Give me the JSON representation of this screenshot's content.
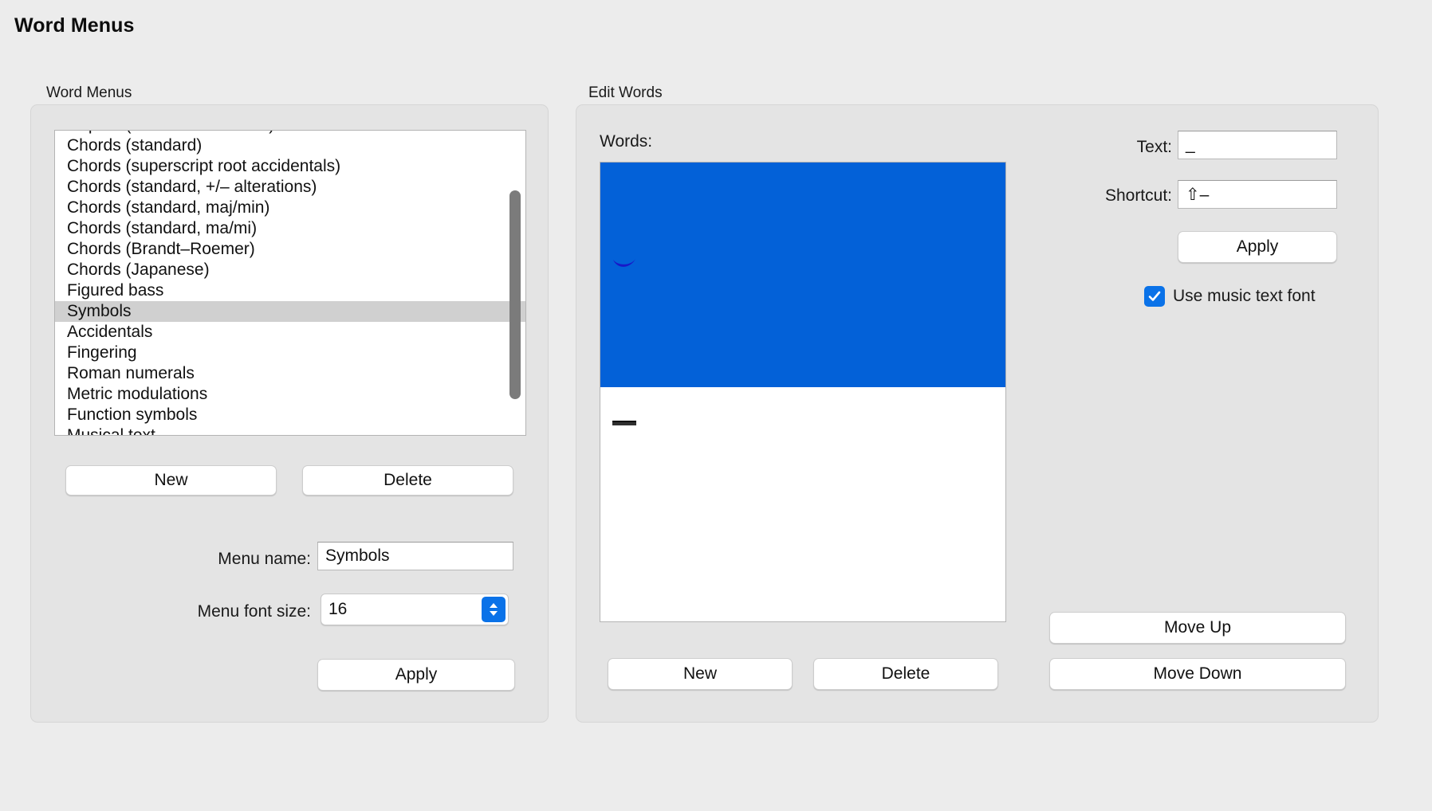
{
  "window": {
    "title": "Word Menus"
  },
  "left_panel": {
    "group_label": "Word Menus",
    "menu_list": [
      {
        "label": "Repeat (D.C./D.S./To Coda)",
        "selected": false
      },
      {
        "label": "Chords (standard)",
        "selected": false
      },
      {
        "label": "Chords (superscript root accidentals)",
        "selected": false
      },
      {
        "label": "Chords (standard, +/– alterations)",
        "selected": false
      },
      {
        "label": "Chords (standard, maj/min)",
        "selected": false
      },
      {
        "label": "Chords (standard, ma/mi)",
        "selected": false
      },
      {
        "label": "Chords (Brandt–Roemer)",
        "selected": false
      },
      {
        "label": "Chords (Japanese)",
        "selected": false
      },
      {
        "label": "Figured bass",
        "selected": false
      },
      {
        "label": "Symbols",
        "selected": true
      },
      {
        "label": "Accidentals",
        "selected": false
      },
      {
        "label": "Fingering",
        "selected": false
      },
      {
        "label": "Roman numerals",
        "selected": false
      },
      {
        "label": "Metric modulations",
        "selected": false
      },
      {
        "label": "Function symbols",
        "selected": false
      },
      {
        "label": "Musical text",
        "selected": false
      }
    ],
    "new_button": "New",
    "delete_button": "Delete",
    "menu_name_label": "Menu name:",
    "menu_name_value": "Symbols",
    "menu_font_size_label": "Menu font size:",
    "menu_font_size_value": "16",
    "apply_button": "Apply"
  },
  "right_panel": {
    "group_label": "Edit Words",
    "words_label": "Words:",
    "words_list": [
      {
        "glyph": "slur-below",
        "selected": true
      },
      {
        "glyph": "tenuto-dash",
        "selected": false
      }
    ],
    "text_label": "Text:",
    "text_value": "_",
    "shortcut_label": "Shortcut:",
    "shortcut_value": "⇧–",
    "apply_button": "Apply",
    "use_music_font_label": "Use music text font",
    "use_music_font_checked": true,
    "new_button": "New",
    "delete_button": "Delete",
    "move_up_button": "Move Up",
    "move_down_button": "Move Down"
  },
  "colors": {
    "window_background": "#ececec",
    "group_background": "#e4e4e4",
    "selection_blue": "#0361d8",
    "accent_blue": "#0a72e8",
    "list_selection_gray": "#d0d0d0",
    "scrollbar_thumb": "#7b7b7b"
  }
}
